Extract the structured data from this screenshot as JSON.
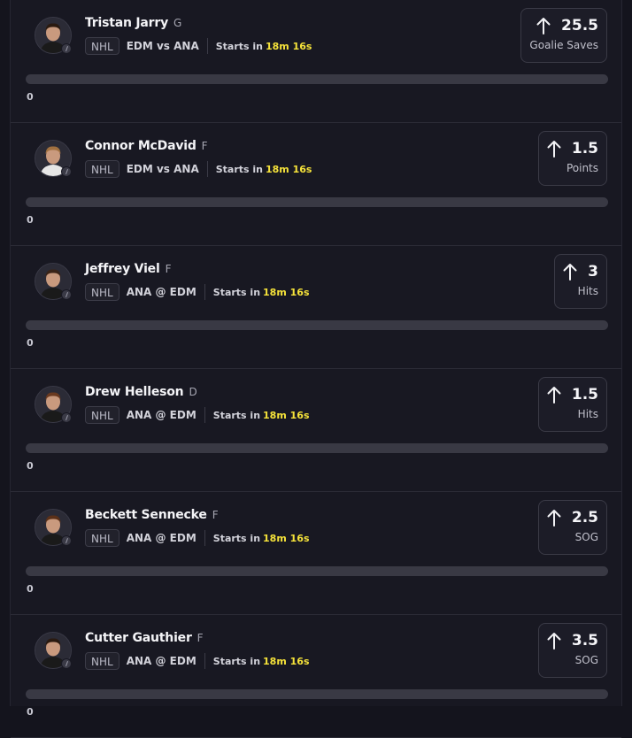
{
  "players": [
    {
      "name": "Tristan Jarry",
      "position": "G",
      "league": "NHL",
      "matchup": "EDM vs ANA",
      "starts_label": "Starts in",
      "countdown": "18m 16s",
      "line": "25.5",
      "stat": "Goalie Saves",
      "direction_icon": "arrow-up-icon",
      "progress": 0,
      "progress_label": "0",
      "jersey_color": "#1a1a1a",
      "hair_color": "#2a1a10"
    },
    {
      "name": "Connor McDavid",
      "position": "F",
      "league": "NHL",
      "matchup": "EDM vs ANA",
      "starts_label": "Starts in",
      "countdown": "18m 16s",
      "line": "1.5",
      "stat": "Points",
      "direction_icon": "arrow-up-icon",
      "progress": 0,
      "progress_label": "0",
      "jersey_color": "#e6e6e6",
      "hair_color": "#a07040"
    },
    {
      "name": "Jeffrey Viel",
      "position": "F",
      "league": "NHL",
      "matchup": "ANA @ EDM",
      "starts_label": "Starts in",
      "countdown": "18m 16s",
      "line": "3",
      "stat": "Hits",
      "direction_icon": "arrow-up-icon",
      "progress": 0,
      "progress_label": "0",
      "jersey_color": "#1a1a1a",
      "hair_color": "#3a2418"
    },
    {
      "name": "Drew Helleson",
      "position": "D",
      "league": "NHL",
      "matchup": "ANA @ EDM",
      "starts_label": "Starts in",
      "countdown": "18m 16s",
      "line": "1.5",
      "stat": "Hits",
      "direction_icon": "arrow-up-icon",
      "progress": 0,
      "progress_label": "0",
      "jersey_color": "#1a1a1a",
      "hair_color": "#6a3a20"
    },
    {
      "name": "Beckett Sennecke",
      "position": "F",
      "league": "NHL",
      "matchup": "ANA @ EDM",
      "starts_label": "Starts in",
      "countdown": "18m 16s",
      "line": "2.5",
      "stat": "SOG",
      "direction_icon": "arrow-up-icon",
      "progress": 0,
      "progress_label": "0",
      "jersey_color": "#1a1a1a",
      "hair_color": "#5a3018"
    },
    {
      "name": "Cutter Gauthier",
      "position": "F",
      "league": "NHL",
      "matchup": "ANA @ EDM",
      "starts_label": "Starts in",
      "countdown": "18m 16s",
      "line": "3.5",
      "stat": "SOG",
      "direction_icon": "arrow-up-icon",
      "progress": 0,
      "progress_label": "0",
      "jersey_color": "#1a1a1a",
      "hair_color": "#2a1a10"
    }
  ],
  "colors": {
    "accent": "#f6e33a",
    "background": "#181822"
  }
}
